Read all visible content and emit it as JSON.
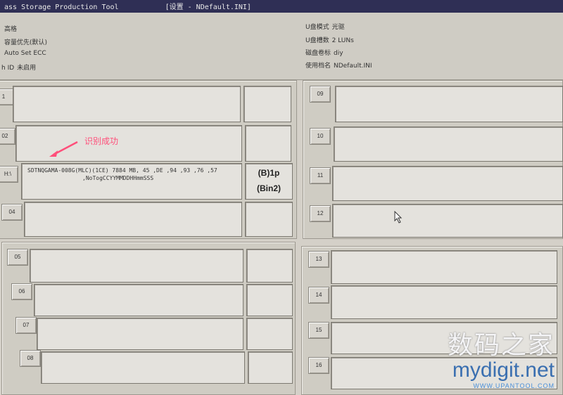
{
  "window": {
    "title": "ass Storage Production Tool",
    "title_extra": "[设置 - NDefault.INI]"
  },
  "info_left": [
    {
      "label": "",
      "value": "高格"
    },
    {
      "label": "",
      "value": "容量优先(默认)"
    },
    {
      "label": "",
      "value": "Auto Set ECC"
    },
    {
      "label": "h ID",
      "value": "未启用"
    }
  ],
  "info_right": [
    {
      "label": "U盘模式",
      "value": "光驱"
    },
    {
      "label": "U盘槽数",
      "value": "2 LUNs"
    },
    {
      "label": "磁盘卷标",
      "value": "diy"
    },
    {
      "label": "使用档名",
      "value": "NDefault.INI"
    }
  ],
  "slots": [
    {
      "id": "1",
      "label": "1"
    },
    {
      "id": "02",
      "label": "02"
    },
    {
      "id": "03",
      "label": "H:\\",
      "device_line1": "SDTNQGAMA-008G(MLC)(1CE) 7884 MB, 45 ,DE ,94 ,93 ,76 ,57",
      "device_line2": ",NoTogCCYYMMDDHHmmSSS",
      "bin_line1": "(B)1p",
      "bin_line2": "(Bin2)"
    },
    {
      "id": "04",
      "label": "04"
    },
    {
      "id": "05",
      "label": "05"
    },
    {
      "id": "06",
      "label": "06"
    },
    {
      "id": "07",
      "label": "07"
    },
    {
      "id": "08",
      "label": "08"
    },
    {
      "id": "09",
      "label": "09"
    },
    {
      "id": "10",
      "label": "10"
    },
    {
      "id": "11",
      "label": "11"
    },
    {
      "id": "12",
      "label": "12"
    },
    {
      "id": "13",
      "label": "13"
    },
    {
      "id": "14",
      "label": "14"
    },
    {
      "id": "15",
      "label": "15"
    },
    {
      "id": "16",
      "label": "16"
    }
  ],
  "annotation": {
    "text": "识别成功",
    "color": "#ff4f7a"
  },
  "watermark": {
    "line1": "数码之家",
    "line2": "mydigit.net",
    "line3": "WWW.UPANTOOL.COM"
  },
  "colors": {
    "window_bg": "#d4d0c8",
    "titlebar": "#2f2f55",
    "annotation": "#ff4f7a"
  }
}
